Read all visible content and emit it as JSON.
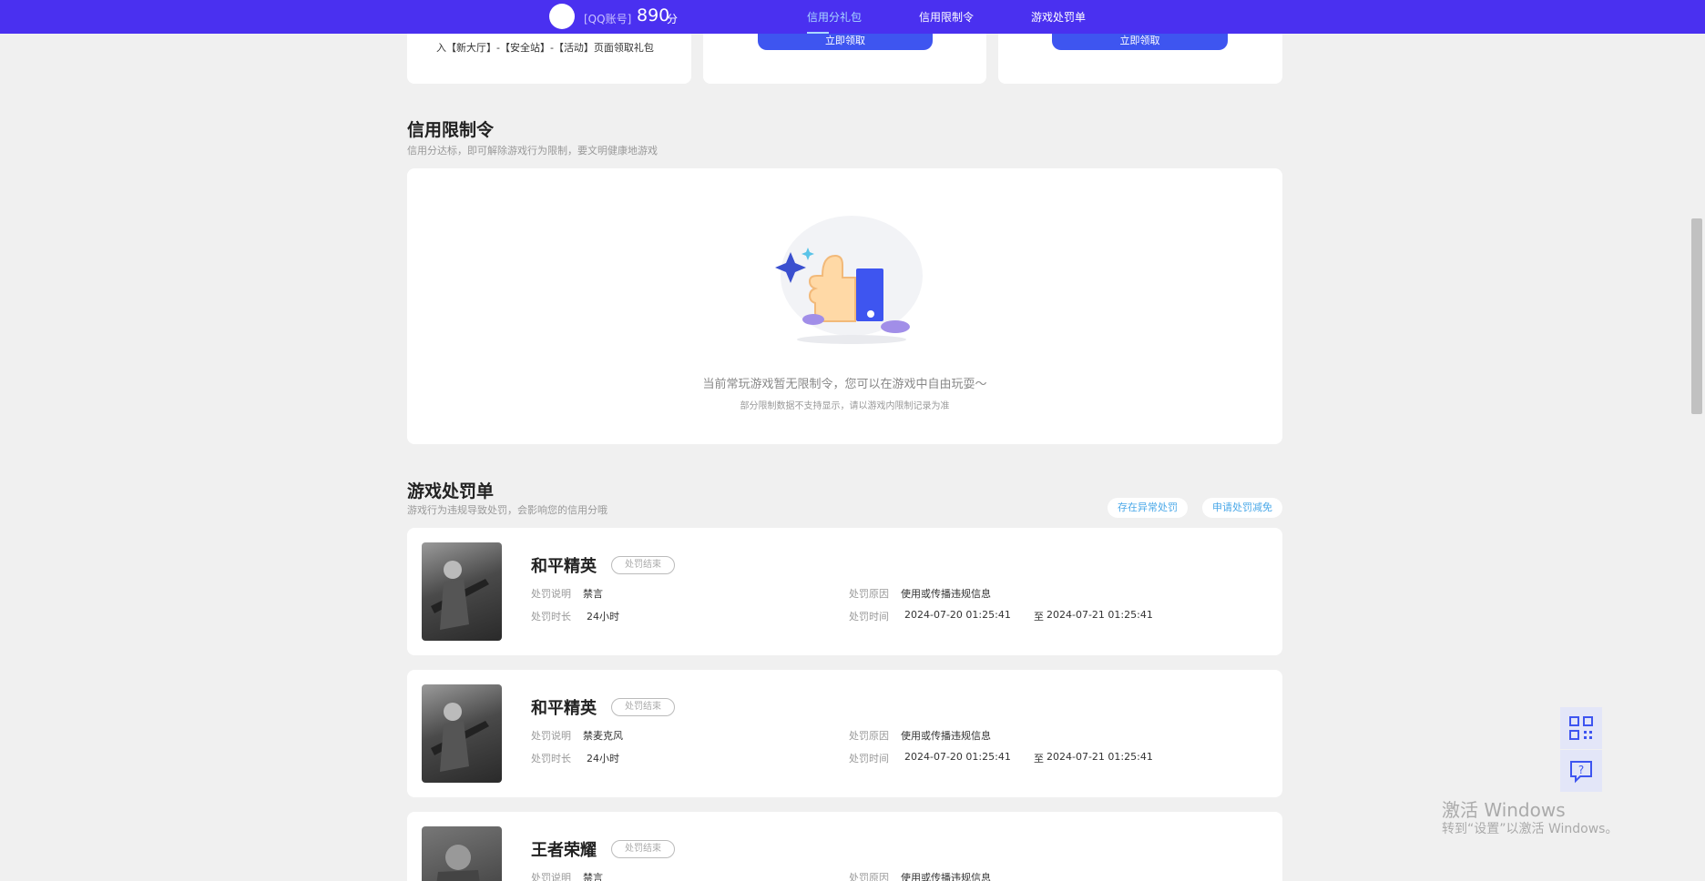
{
  "header": {
    "account_label": "[QQ账号]",
    "score": "890",
    "score_unit": "分",
    "nav": [
      "信用分礼包",
      "信用限制令",
      "游戏处罚单"
    ]
  },
  "gift_cards": {
    "card1_text": "入【新大厅】-【安全站】-【活动】页面领取礼包",
    "claim_label": "立即领取"
  },
  "restriction": {
    "title": "信用限制令",
    "subtitle": "信用分达标，即可解除游戏行为限制，要文明健康地游戏",
    "empty_main": "当前常玩游戏暂无限制令，您可以在游戏中自由玩耍～",
    "empty_sub": "部分限制数据不支持显示，请以游戏内限制记录为准"
  },
  "penalty": {
    "title": "游戏处罚单",
    "subtitle": "游戏行为违规导致处罚，会影响您的信用分哦",
    "btn_abnormal": "存在异常处罚",
    "btn_appeal": "申请处罚减免",
    "labels": {
      "desc": "处罚说明",
      "duration": "处罚时长",
      "reason": "处罚原因",
      "time": "处罚时间",
      "to": "至"
    },
    "items": [
      {
        "game": "和平精英",
        "status": "处罚结束",
        "desc": "禁言",
        "duration": "24小时",
        "reason": "使用或传播违规信息",
        "start": "2024-07-20 01:25:41",
        "end": "2024-07-21 01:25:41"
      },
      {
        "game": "和平精英",
        "status": "处罚结束",
        "desc": "禁麦克风",
        "duration": "24小时",
        "reason": "使用或传播违规信息",
        "start": "2024-07-20 01:25:41",
        "end": "2024-07-21 01:25:41"
      },
      {
        "game": "王者荣耀",
        "status": "处罚结束",
        "desc": "禁言",
        "duration": "",
        "reason": "使用或传播违规信息",
        "start": "",
        "end": ""
      }
    ]
  },
  "watermark": {
    "line1": "激活 Windows",
    "line2": "转到“设置”以激活 Windows。"
  },
  "colors": {
    "nav_bg": "#4a30f0",
    "accent": "#3e55f0",
    "link": "#4aa8e8"
  }
}
